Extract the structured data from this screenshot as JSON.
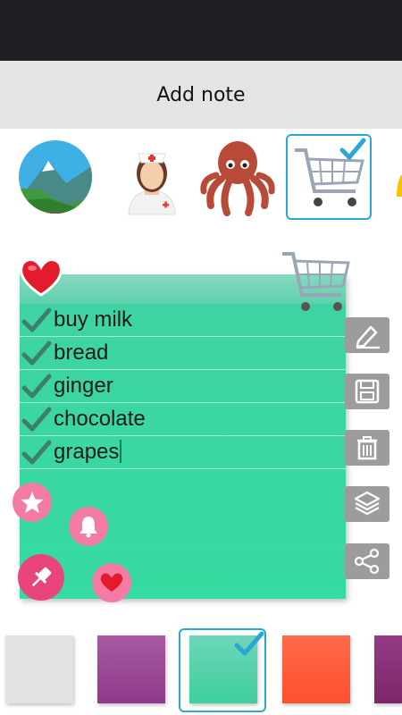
{
  "header": {
    "title": "Add note"
  },
  "stickers": [
    {
      "name": "mountain-landscape-icon"
    },
    {
      "name": "nurse-icon"
    },
    {
      "name": "octopus-icon"
    },
    {
      "name": "shopping-cart-icon",
      "selected": true
    },
    {
      "name": "bell-icon"
    }
  ],
  "note": {
    "color": "#35dba0",
    "items": [
      {
        "text": "buy milk",
        "checked": true
      },
      {
        "text": "bread",
        "checked": true
      },
      {
        "text": "ginger",
        "checked": true
      },
      {
        "text": "chocolate",
        "checked": true
      },
      {
        "text": "grapes",
        "checked": true
      }
    ]
  },
  "side_actions": [
    "edit-icon",
    "save-icon",
    "delete-icon",
    "layers-icon",
    "share-icon"
  ],
  "note_actions": [
    "star-icon",
    "bell-icon",
    "pin-icon",
    "heart-icon"
  ],
  "swatches": [
    {
      "color": "#e3e3e3"
    },
    {
      "color": "#9b3f96"
    },
    {
      "color": "#48d3a6",
      "selected": true
    },
    {
      "color": "#ff5a3c"
    },
    {
      "color": "#8a2c78"
    }
  ],
  "colors": {
    "accent": "#2aa7d6",
    "pink": "#f06c9b",
    "side_button": "#9c9c9c"
  }
}
